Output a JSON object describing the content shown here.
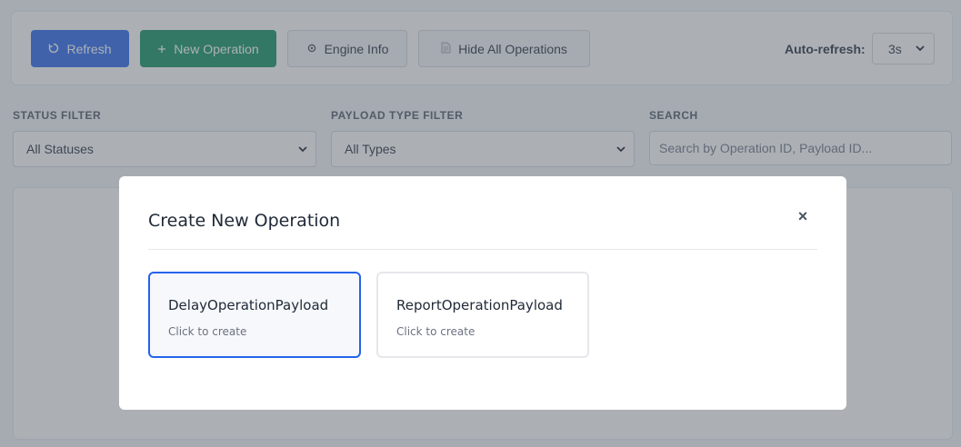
{
  "toolbar": {
    "refresh_label": "Refresh",
    "new_operation_label": "New Operation",
    "engine_info_label": "Engine Info",
    "hide_all_label": "Hide All Operations",
    "auto_refresh_label": "Auto-refresh:",
    "auto_refresh_value": "3s",
    "icons": {
      "refresh": "refresh-icon",
      "new_operation": "plus-icon",
      "engine_info": "gear-icon",
      "hide_all": "document-icon"
    },
    "colors": {
      "refresh": "#2563eb",
      "new_operation": "#0b8f5c"
    }
  },
  "filters": {
    "status_label": "STATUS FILTER",
    "status_value": "All Statuses",
    "payload_type_label": "PAYLOAD TYPE FILTER",
    "payload_type_value": "All Types",
    "search_label": "SEARCH",
    "search_placeholder": "Search by Operation ID, Payload ID..."
  },
  "modal": {
    "title": "Create New Operation",
    "close_symbol": "×",
    "options": [
      {
        "name": "DelayOperationPayload",
        "subtitle": "Click to create",
        "selected": true
      },
      {
        "name": "ReportOperationPayload",
        "subtitle": "Click to create",
        "selected": false
      }
    ]
  }
}
